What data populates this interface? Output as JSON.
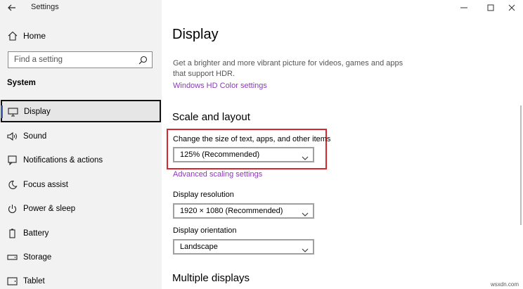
{
  "app": {
    "title": "Settings"
  },
  "sidebar": {
    "home_label": "Home",
    "search_placeholder": "Find a setting",
    "section_title": "System",
    "items": [
      {
        "label": "Display",
        "icon": "monitor-icon",
        "selected": true
      },
      {
        "label": "Sound",
        "icon": "speaker-icon"
      },
      {
        "label": "Notifications & actions",
        "icon": "notification-icon"
      },
      {
        "label": "Focus assist",
        "icon": "moon-icon"
      },
      {
        "label": "Power & sleep",
        "icon": "power-icon"
      },
      {
        "label": "Battery",
        "icon": "battery-icon"
      },
      {
        "label": "Storage",
        "icon": "storage-icon"
      },
      {
        "label": "Tablet",
        "icon": "tablet-icon"
      }
    ]
  },
  "main": {
    "title": "Display",
    "hdr_description": "Get a brighter and more vibrant picture for videos, games and apps that support HDR.",
    "hdr_link": "Windows HD Color settings",
    "scale_section": "Scale and layout",
    "scale_label": "Change the size of text, apps, and other items",
    "scale_value": "125% (Recommended)",
    "advanced_link": "Advanced scaling settings",
    "resolution_label": "Display resolution",
    "resolution_value": "1920 × 1080 (Recommended)",
    "orientation_label": "Display orientation",
    "orientation_value": "Landscape",
    "multiple_section": "Multiple displays"
  },
  "watermark": "wsxdn.com",
  "colors": {
    "link": "#8a3ab9",
    "highlight": "#d8262f",
    "accent": "#3f5fa8",
    "sidebar_bg": "#f2f2f2"
  }
}
